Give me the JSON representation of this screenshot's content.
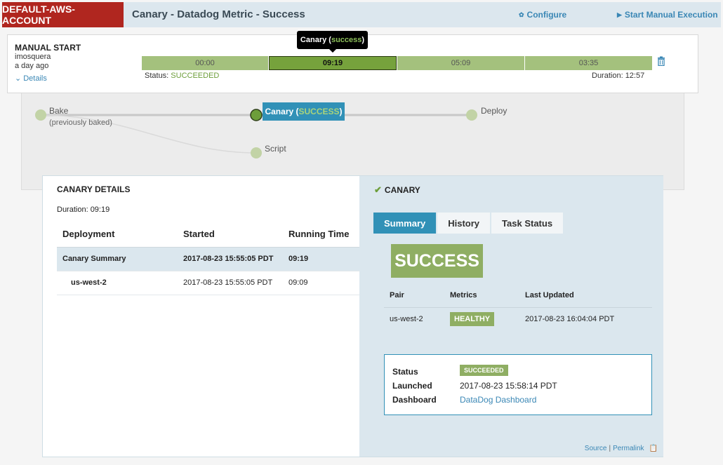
{
  "header": {
    "account": "DEFAULT-AWS-ACCOUNT",
    "title": "Canary - Datadog Metric - Success",
    "configure_label": "Configure",
    "start_label": "Start Manual Execution"
  },
  "execution": {
    "trigger_title": "MANUAL START",
    "user": "imosquera",
    "when": "a day ago",
    "details_label": "Details",
    "segments": [
      "00:00",
      "09:19",
      "05:09",
      "03:35"
    ],
    "status_label": "Status: ",
    "status_value": "SUCCEEDED",
    "duration_text": "Duration: 12:57",
    "tooltip_stage": "Canary (",
    "tooltip_status": "success",
    "tooltip_end": ")"
  },
  "graph": {
    "bake_label": "Bake",
    "bake_sub": "(previously baked)",
    "canary_label": "Canary (",
    "canary_status": "SUCCESS",
    "canary_end": ")",
    "deploy_label": "Deploy",
    "script_label": "Script"
  },
  "canary_details": {
    "title": "CANARY DETAILS",
    "duration": "Duration: 09:19",
    "columns": [
      "Deployment",
      "Started",
      "Running Time"
    ],
    "rows": [
      {
        "deployment": "Canary Summary",
        "started": "2017-08-23 15:55:05 PDT",
        "running": "09:19"
      },
      {
        "deployment": "us-west-2",
        "started": "2017-08-23 15:55:05 PDT",
        "running": "09:09"
      }
    ]
  },
  "canary_panel": {
    "title": "CANARY",
    "tabs": [
      "Summary",
      "History",
      "Task Status"
    ],
    "result": "SUCCESS",
    "columns": [
      "Pair",
      "Metrics",
      "Last Updated"
    ],
    "pair_row": {
      "pair": "us-west-2",
      "metrics": "HEALTHY",
      "updated": "2017-08-23 16:04:04 PDT"
    },
    "status_key": "Status",
    "status_value": "SUCCEEDED",
    "launched_key": "Launched",
    "launched_value": "2017-08-23 15:58:14 PDT",
    "dashboard_key": "Dashboard",
    "dashboard_value": "DataDog Dashboard",
    "source_label": "Source",
    "permalink_label": "Permalink"
  }
}
